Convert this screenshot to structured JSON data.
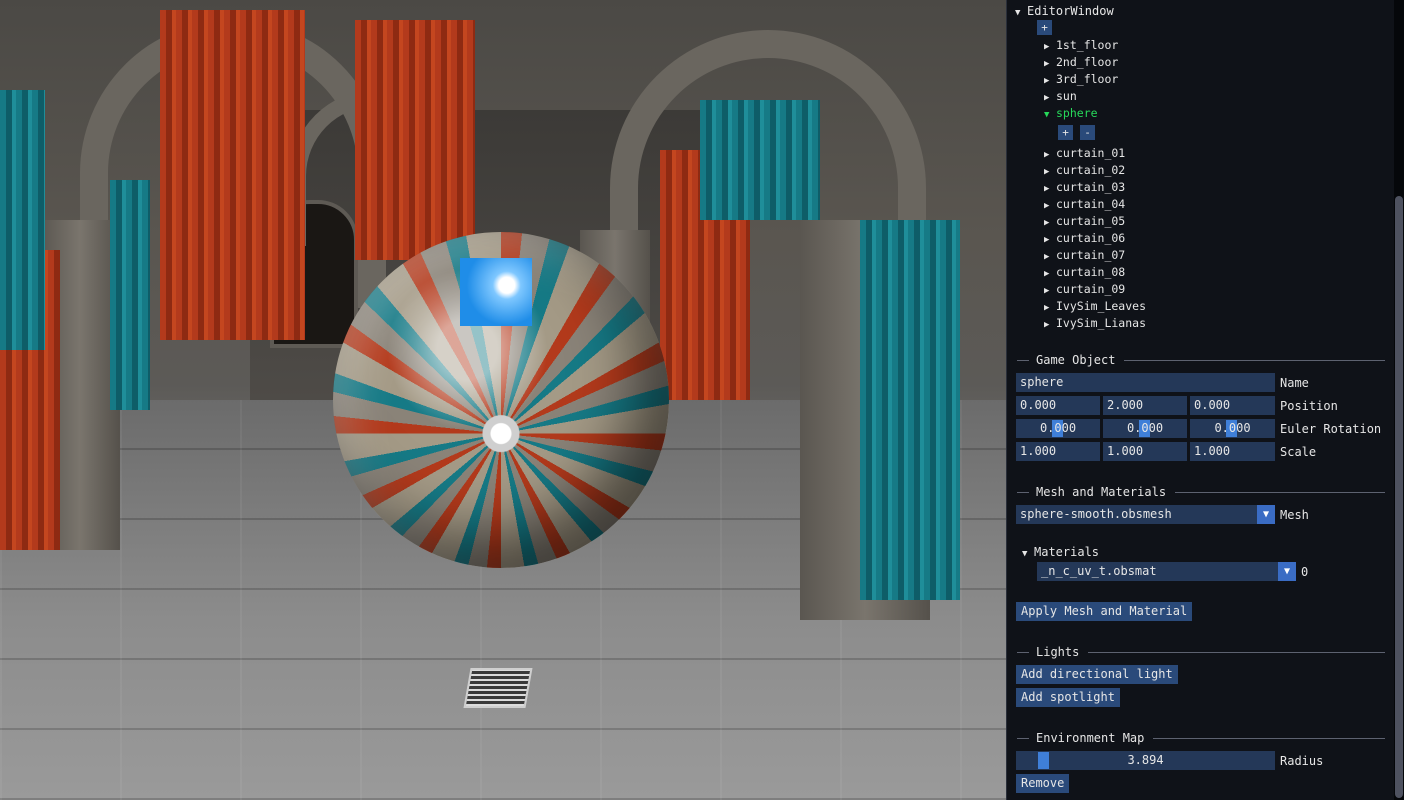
{
  "window": {
    "title": "EditorWindow"
  },
  "tree": {
    "add_root_label": "+",
    "items": [
      {
        "label": "1st_floor",
        "expanded": false,
        "selected": false
      },
      {
        "label": "2nd_floor",
        "expanded": false,
        "selected": false
      },
      {
        "label": "3rd_floor",
        "expanded": false,
        "selected": false
      },
      {
        "label": "sun",
        "expanded": false,
        "selected": false
      },
      {
        "label": "sphere",
        "expanded": true,
        "selected": true
      },
      {
        "label": "curtain_01",
        "expanded": false,
        "selected": false
      },
      {
        "label": "curtain_02",
        "expanded": false,
        "selected": false
      },
      {
        "label": "curtain_03",
        "expanded": false,
        "selected": false
      },
      {
        "label": "curtain_04",
        "expanded": false,
        "selected": false
      },
      {
        "label": "curtain_05",
        "expanded": false,
        "selected": false
      },
      {
        "label": "curtain_06",
        "expanded": false,
        "selected": false
      },
      {
        "label": "curtain_07",
        "expanded": false,
        "selected": false
      },
      {
        "label": "curtain_08",
        "expanded": false,
        "selected": false
      },
      {
        "label": "curtain_09",
        "expanded": false,
        "selected": false
      },
      {
        "label": "IvySim_Leaves",
        "expanded": false,
        "selected": false
      },
      {
        "label": "IvySim_Lianas",
        "expanded": false,
        "selected": false
      }
    ],
    "child_add_label": "+",
    "child_remove_label": "-"
  },
  "game_object": {
    "header": "Game Object",
    "name_value": "sphere",
    "name_label": "Name",
    "position": [
      "0.000",
      "2.000",
      "0.000"
    ],
    "position_label": "Position",
    "euler_rotation": [
      "0.000",
      "0.000",
      "0.000"
    ],
    "euler_rotation_label": "Euler Rotation",
    "scale": [
      "1.000",
      "1.000",
      "1.000"
    ],
    "scale_label": "Scale"
  },
  "mesh_materials": {
    "header": "Mesh and Materials",
    "mesh_value": "sphere-smooth.obsmesh",
    "mesh_label": "Mesh",
    "materials_header": "Materials",
    "material_value": "_n_c_uv_t.obsmat",
    "material_index": "0",
    "apply_button": "Apply Mesh and Material"
  },
  "lights": {
    "header": "Lights",
    "add_directional_button": "Add directional light",
    "add_spotlight_button": "Add spotlight"
  },
  "environment_map": {
    "header": "Environment Map",
    "radius_value": "3.894",
    "radius_label": "Radius",
    "remove_button": "Remove"
  },
  "icons": {
    "collapse": "triangle-down-icon",
    "expand": "triangle-right-icon",
    "combo": "combo-arrow-down-icon"
  },
  "colors": {
    "panel_bg": "#0f1218",
    "field_bg": "#243858",
    "button_bg": "#2a4a7a",
    "selected_text": "#27d95a",
    "accent": "#3f7fd8"
  }
}
